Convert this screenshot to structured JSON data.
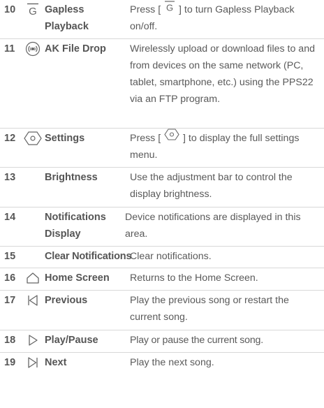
{
  "rows": [
    {
      "number": "10",
      "icon": "gapless-g-icon",
      "function": "Gapless Playback",
      "desc_pre": "Press [ ",
      "desc_post": " ] to turn Gapless Playback on/off."
    },
    {
      "number": "11",
      "icon": "file-drop-icon",
      "function": "AK File Drop",
      "desc": "Wirelessly upload or download files to and from devices on the same network (PC, tablet, smartphone, etc.) using the PPS22 via an FTP program."
    },
    {
      "number": "12",
      "icon": "settings-hexagon-icon",
      "function": "Settings",
      "desc_pre": "Press [ ",
      "desc_post": " ] to display the full settings menu."
    },
    {
      "number": "13",
      "icon": "",
      "function": "Brightness",
      "desc": "Use the adjustment bar to control the display brightness."
    },
    {
      "number": "14",
      "icon": "",
      "function": "Notifications Display",
      "desc": "Device notifications are displayed in this area."
    },
    {
      "number": "15",
      "icon": "",
      "function": "Clear Notifications",
      "desc": "Clear notifications."
    },
    {
      "number": "16",
      "icon": "home-icon",
      "function": "Home Screen",
      "desc": "Returns to the Home Screen."
    },
    {
      "number": "17",
      "icon": "previous-icon",
      "function": "Previous",
      "desc": "Play the previous song or restart the current song."
    },
    {
      "number": "18",
      "icon": "play-icon",
      "function": "Play/Pause",
      "desc": "Play or pause the current song."
    },
    {
      "number": "19",
      "icon": "next-icon",
      "function": "Next",
      "desc": "Play the next song."
    }
  ]
}
